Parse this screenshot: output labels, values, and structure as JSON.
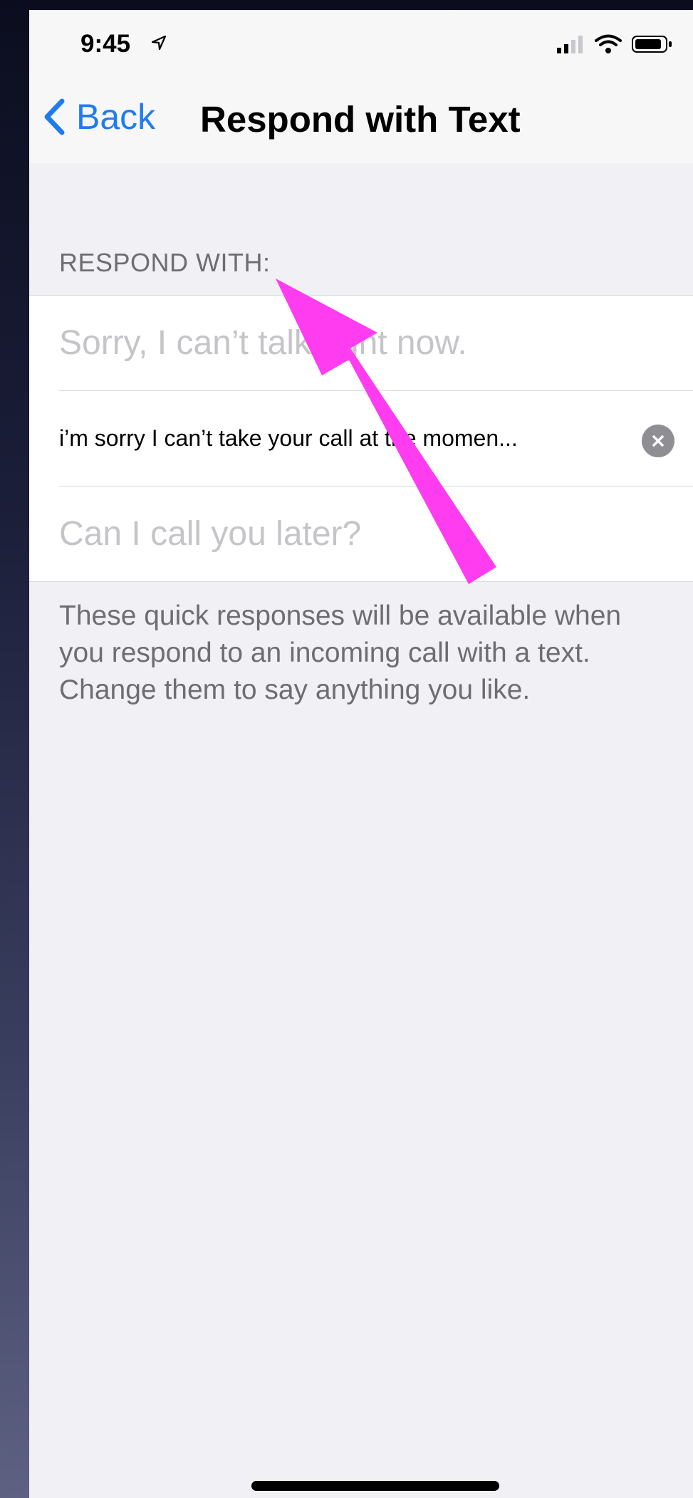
{
  "status_bar": {
    "time": "9:45",
    "icons": [
      "location-arrow-icon",
      "signal-icon",
      "wifi-icon",
      "battery-icon"
    ]
  },
  "nav": {
    "back_label": "Back",
    "title": "Respond with Text"
  },
  "section": {
    "header": "RESPOND WITH:"
  },
  "responses": [
    {
      "placeholder": "Sorry, I can’t talk right now.",
      "value": ""
    },
    {
      "placeholder": "",
      "value": "i’m sorry I can’t take your call at the momen..."
    },
    {
      "placeholder": "Can I call you later?",
      "value": ""
    }
  ],
  "footer": {
    "note": "These quick responses will be available when you respond to an incoming call with a text. Change them to say anything you like."
  },
  "colors": {
    "accent": "#1f7cf0",
    "annotation_arrow": "#ff3cf0"
  }
}
